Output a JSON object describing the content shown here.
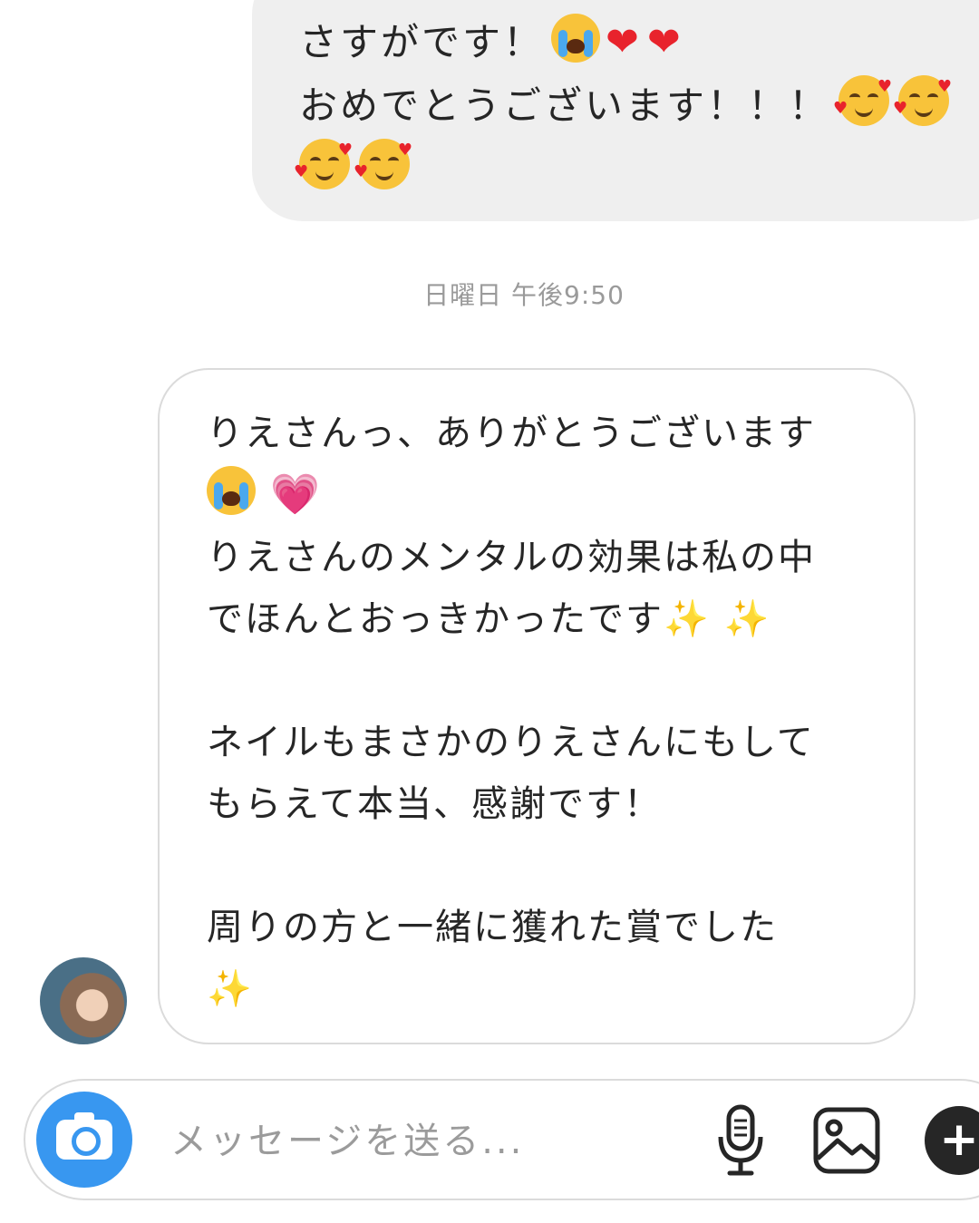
{
  "sent_message": {
    "line1_text": "さすがです！",
    "line2_text": "おめでとうございます！！！"
  },
  "timestamp": "日曜日 午後9:50",
  "received_message": {
    "line1": "りえさんっ、ありがとうございます",
    "line3": "りえさんのメンタルの効果は私の中",
    "line4": "でほんとおっきかったです",
    "line5": "ネイルもまさかのりえさんにもして",
    "line6": "もらえて本当、感謝です！",
    "line7": "周りの方と一緒に獲れた賞でした"
  },
  "composer": {
    "placeholder": "メッセージを送る..."
  },
  "icons": {
    "camera": "camera-icon",
    "microphone": "microphone-icon",
    "gallery": "image-gallery-icon",
    "plus": "plus-icon"
  },
  "colors": {
    "camera_button": "#3897f0",
    "sent_bubble": "#efefef",
    "bubble_border": "#dbdbdb",
    "timestamp": "#9a9a9a"
  }
}
